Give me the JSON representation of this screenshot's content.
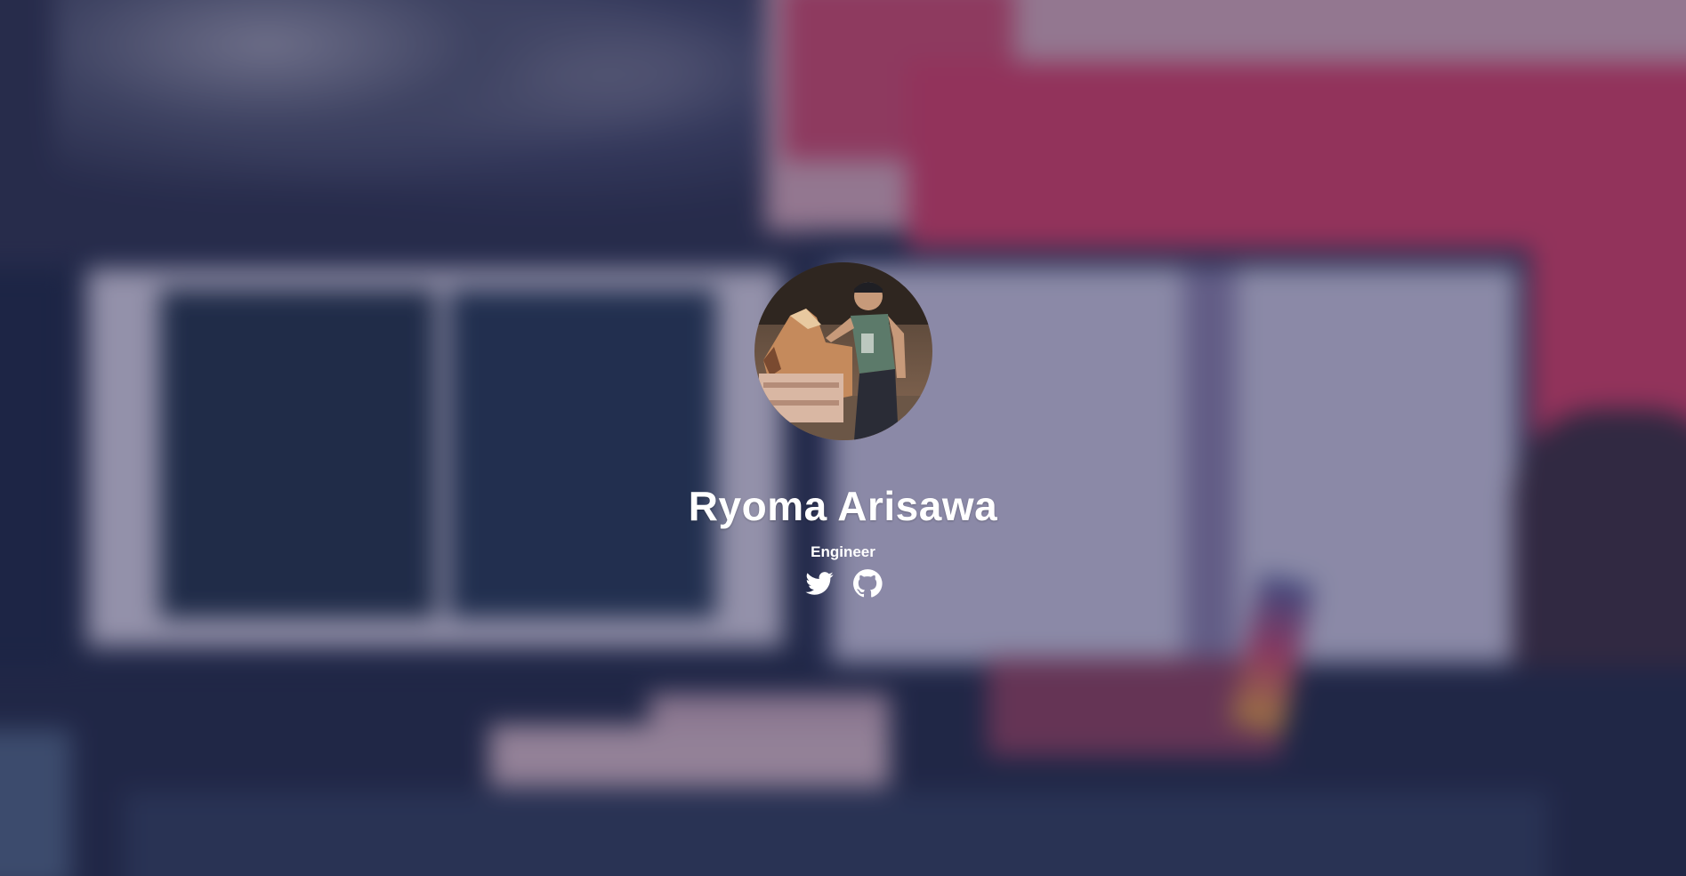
{
  "profile": {
    "name": "Ryoma Arisawa",
    "role": "Engineer",
    "avatar_icon": "profile-photo"
  },
  "social_links": [
    {
      "icon": "twitter-icon"
    },
    {
      "icon": "github-icon"
    }
  ],
  "colors": {
    "text": "#ffffff",
    "overlay": "#222850",
    "accent_red": "#d73a63"
  }
}
